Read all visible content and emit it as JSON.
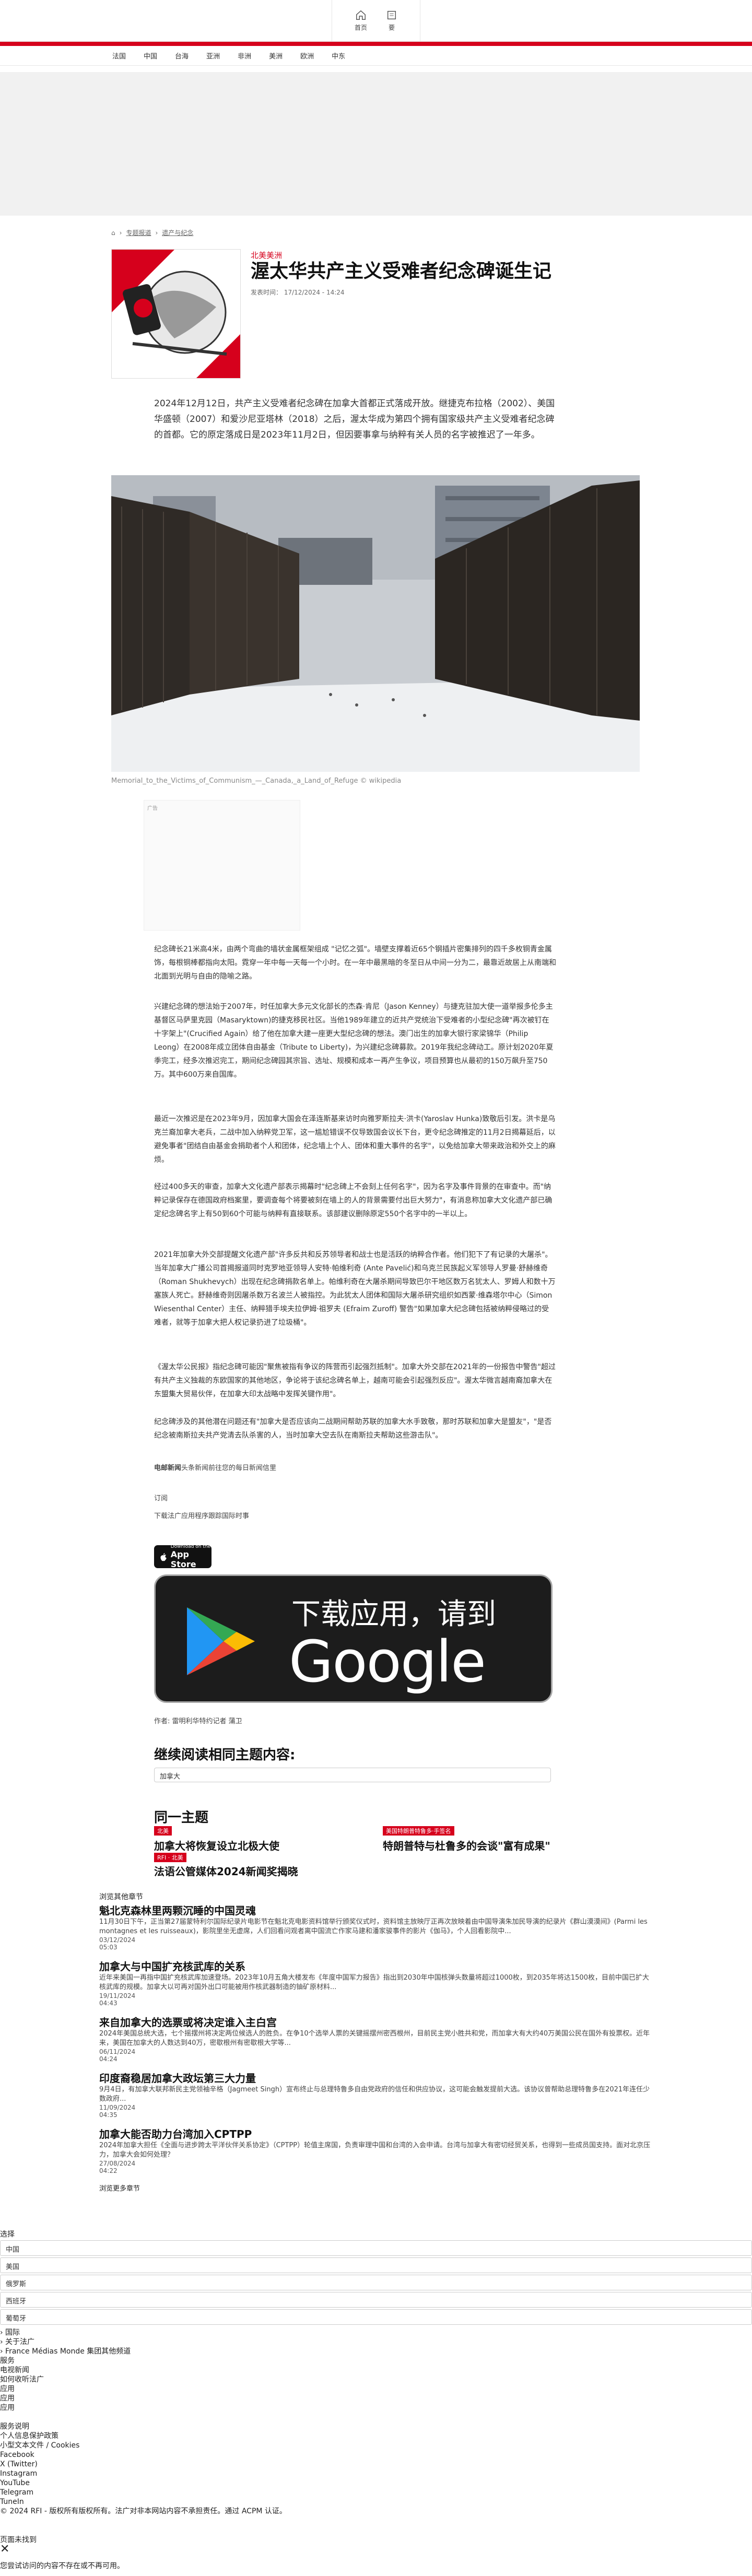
{
  "header": {
    "home": "首页",
    "news": "要"
  },
  "subnav": [
    "法国",
    "中国",
    "台海",
    "亚洲",
    "非洲",
    "美洲",
    "欧洲",
    "中东"
  ],
  "breadcrumb": [
    "专题报道",
    "遗产与纪念"
  ],
  "article": {
    "category": "北美美洲",
    "title": "渥太华共产主义受难者纪念碑诞生记",
    "meta": "发表时间： 17/12/2024 - 14:24",
    "lead": "2024年12月12日，共产主义受难者纪念碑在加拿大首都正式落成开放。继捷克布拉格（2002）、美国华盛顿（2007）和爱沙尼亚塔林（2018）之后，渥太华成为第四个拥有国家级共产主义受难者纪念碑的首都。它的原定落成日是2023年11月2日，但因要事拿与纳粹有关人员的名字被推迟了一年多。",
    "caption": "Memorial_to_the_Victims_of_Communism_—_Canada,_a_Land_of_Refuge © wikipedia",
    "ad_label": "广告",
    "p1": "纪念碑长21米高4米，由两个弯曲的墙状金属框架组成 \"记忆之弧\"。墙壁支撑着近65个钢插片密集排列的四千多枚铜青金属饰，每根铜棒都指向太阳。霓穿一年中每一天每一个小时。在一年中最黑暗的冬至日从中间一分为二，最靠近故居上从南端和北面到光明与自由的隐喻之路。",
    "p2": "兴建纪念碑的想法始于2007年，时任加拿大多元文化部长的杰森·肯尼（Jason Kenney）与捷克驻加大使一道举报多伦多主基督区马萨里克园（Masaryktown)的捷克移民社区。当他1989年建立的近共产党统治下受难者的小型纪念碑\"再次被钉在十字架上\"(Crucified Again）给了他在加拿大建一座更大型纪念碑的想法。澳门出生的加拿大银行家梁锦华（Philip Leong）在2008年成立团体自由基金（Tribute to Liberty)，为兴建纪念碑募款。2019年我纪念碑动工。原计划2020年夏季完工，经多次推迟完工，期间纪念碑园其宗旨、选址、规模和成本一再产生争议，项目预算也从最初的150万飙升至750万。其中600万来自国库。",
    "p3": "最近一次推迟是在2023年9月，因加拿大国会在泽连斯基来访时向雅罗斯拉夫·洪卡(Yaroslav Hunka)致敬后引发。洪卡是乌克兰裔加拿大老兵，二战中加入纳粹党卫军，这一尴尬错误不仅导致国会议长下台，更令纪念碑推定的11月2日揭幕延后，以避免事者\"团结自由基金会捐助者个人和团体，纪念墙上个人、团体和重大事件的名字\"，以免给加拿大带来政治和外交上的麻烦。",
    "p4": "经过400多天的审查，加拿大文化遗产部表示揭幕时\"纪念碑上不会刻上任何名字\"，因为名字及事件背景的在审查中。而\"纳粹记录保存在德国政府档案里，要调查每个将要被刻在墙上的人的背景需要付出巨大努力\"，有消息称加拿大文化遗产部已确定纪念碑名字上有50到60个可能与纳粹有直接联系。该部建议删除原定550个名字中的一半以上。",
    "p5": "2021年加拿大外交部提醒文化遗产部\"许多反共和反苏领导者和战士也是活跃的纳粹合作者。他们犯下了有记录的大屠杀\"。当年加拿大广播公司首揭报道同时克罗地亚领导人安特·帕维利奇 (Ante Pavelić)和乌克兰民族起义军领导人罗曼·舒赫维奇（Roman Shukhevych）出现在纪念碑捐款名单上。帕维利奇在大屠杀期间导致巴尔干地区数万名犹太人、罗姆人和数十万塞族人死亡。舒赫维奇则因屠杀数万名波兰人被指控。为此犹太人团体和国际大屠杀研究组织如西蒙·维森塔尔中心（Simon Wiesenthal Center）主任、纳粹猎手埃夫拉伊姆·祖罗夫 (Efraim Zuroff) 警告\"如果加拿大纪念碑包括被纳粹侵略过的受难者，就等于加拿大把人权记录扔进了垃圾桶\"。",
    "p6": "《渥太华公民报》指纪念碑可能因\"聚焦被指有争议的阵营而引起强烈抵制\"。加拿大外交部在2021年的一份报告中警告\"超过有共产主义独裁的东欧国家的其他地区，争论将于该纪念碑名单上，越南可能会引起强烈反应\"。渥太华微言越南裔加拿大在东盟集大贸易伙伴，在加拿大印太战略中发挥关键作用\"。",
    "p7": "纪念碑涉及的其他潜在问题还有\"加拿大是否应该向二战期间帮助苏联的加拿大水手致敬，那时苏联和加拿大是盟友\"，\"是否纪念被南斯拉夫共产党清去队杀害的人，当时加拿大空去队在南斯拉夫帮助这些游击队\"。",
    "subscribe_lead": "电邮新闻",
    "subscribe_text": "头条新闻前往您的每日新闻信里",
    "subscribe_button": "订阅",
    "download_text": "下载法广应用程序跟踪国际时事",
    "appstore_small": "Download on the",
    "appstore_big": "App Store",
    "gplay_line1": "下载应用，请到",
    "gplay_line2": "Google Play",
    "author": "作者:   雷明利华特约记者 蒲卫"
  },
  "more": {
    "heading": "继续阅读相同主题内容:",
    "tag": "加拿大"
  },
  "same_topic": {
    "heading": "同一主题",
    "items": [
      {
        "badge": "北美",
        "title": "加拿大将恢复设立北极大使",
        "badge2": "RFI · 北美"
      },
      {
        "badge": "美国特朗普特鲁多·手签名",
        "title": "特朗普特与杜鲁多的会谈\"富有成果\""
      },
      {
        "title": "法语公管媒体2024新闻奖揭晓"
      }
    ]
  },
  "feed": {
    "label": "浏览其他章节",
    "items": [
      {
        "title": "魁北克森林里两颗沉睡的中国灵魂",
        "desc": "11月30日下午，正当第27届蒙特利尔国际纪录片电影节在魁北克电影资料馆举行颁奖仪式时，资料馆主放映厅正再次放映着由中国导演朱加民导演的纪录片《群山漠漠间》(Parmi les montagnes et les ruisseaux)，影院里坐无虚席，人们回看问观者离中国流亡作家马建和潘家骏事件的影片《伽马》，个人回看影院中...",
        "date": "03/12/2024",
        "time": "05:03"
      },
      {
        "title": "加拿大与中国扩充核武库的关系",
        "desc": "近年来美国一再指中国扩充核武库加速登场。2023年10月五角大楼发布《年度中国军力报告》指出到2030年中国核弹头数量将超过1000枚，到2035年将达1500枚，目前中国已扩大核武库的规模。加拿大以可再对国外出口可能被用作核武器制造的铀矿原材料...",
        "date": "19/11/2024",
        "time": "04:43"
      },
      {
        "title": "来自加拿大的选票或将决定谁入主白宫",
        "desc": "2024年美国总统大选，七个摇摆州将决定两位候选人的胜负。在争10个选举人票的关键摇摆州密西根州，目前民主党小胜共和党，而加拿大有大约40万美国公民在国外有投票权。近年来，美国在加拿大的人数达到40万，密歇根州有密歇根大学等...",
        "date": "06/11/2024",
        "time": "04:24"
      },
      {
        "title": "印度裔稳居加拿大政坛第三大力量",
        "desc": "9月4日，有加拿大联邦新民主党领袖辛格（Jagmeet Singh）宣布终止与总理特鲁多自由党政府的信任和供应协议，这可能会触发提前大选。该协议曾帮助总理特鲁多在2021年连任少数政府...",
        "date": "11/09/2024",
        "time": "04:35"
      },
      {
        "title": "加拿大能否助力台湾加入CPTPP",
        "desc": "2024年加拿大担任《全面与进步跨太平洋伙伴关系协定》（CPTPP）轮值主席国，负责审理中国和台湾的入会申请。台湾与加拿大有密切经贸关系，也得到一些成员国支持。面对北京压力，加拿大会如何处理？",
        "date": "27/08/2024",
        "time": "04:22"
      }
    ],
    "more": "浏览更多章节"
  },
  "footer": {
    "lang_label": "选择",
    "langs": [
      "中国",
      "美国",
      "俄罗斯",
      "西班牙",
      "葡萄牙"
    ],
    "links": [
      "› 国际",
      "› 关于法广",
      "› France Médias Monde 集团其他频道",
      "服务",
      "电视新闻",
      "如何收听法广",
      "应用",
      "应用",
      "应用",
      "",
      "服务说明",
      "个人信息保护政策",
      "小型文本文件 / Cookies",
      "Facebook",
      "X (Twitter)",
      "Instagram",
      "YouTube",
      "Telegram",
      "TuneIn"
    ],
    "copyright": "© 2024 RFI - 版权所有版权所有。法广对非本网站内容不承担责任。通过 ACPM 认证。",
    "search_label": "页面未找到",
    "close": "✕",
    "notice": "您尝试访问的内容不存在或不再可用。"
  },
  "colors": {
    "accent": "#d6001c"
  }
}
